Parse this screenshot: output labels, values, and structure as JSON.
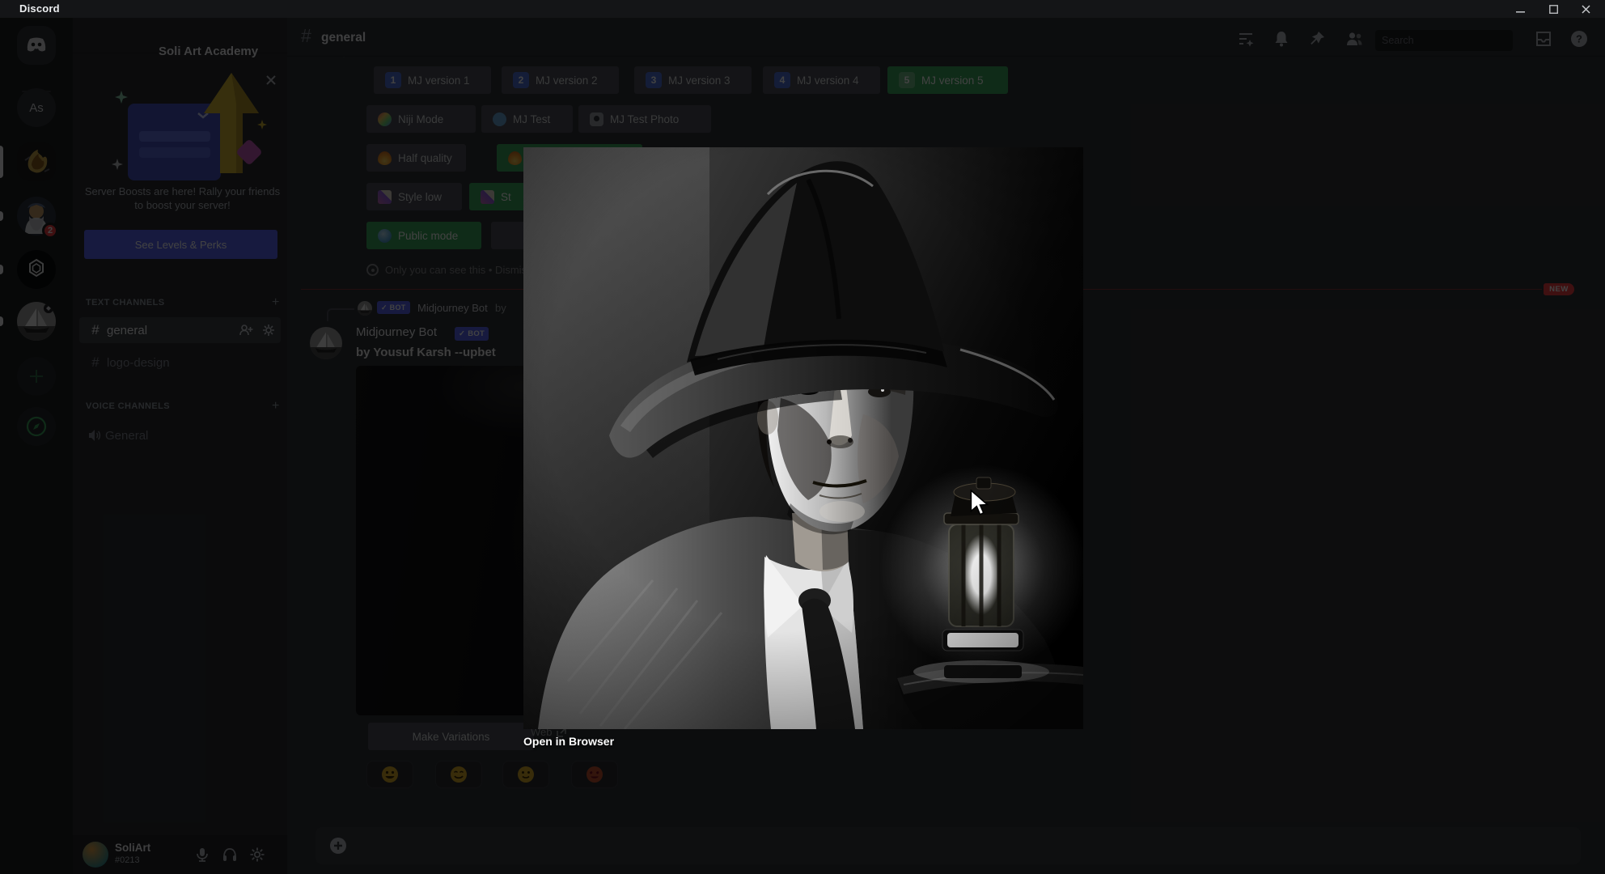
{
  "titlebar": {
    "app_name": "Discord"
  },
  "rail": {
    "as_server_label": "As",
    "wizard_badge": "2",
    "icon_names": [
      "discord-home-icon",
      "server-as",
      "server-soli-art",
      "server-wizard",
      "server-openai",
      "server-sailboat",
      "add-server-icon",
      "explore-compass-icon"
    ]
  },
  "sidebar": {
    "server_name": "Soli Art Academy",
    "boost": {
      "message": "Server Boosts are here! Rally your friends to boost your server!",
      "button_label": "See Levels & Perks"
    },
    "text_channels_label": "TEXT CHANNELS",
    "voice_channels_label": "VOICE CHANNELS",
    "channels": [
      {
        "name": "general"
      },
      {
        "name": "logo-design"
      }
    ],
    "voice_channels": [
      {
        "name": "General"
      }
    ],
    "user": {
      "name": "SoliArt",
      "tag": "#0213"
    }
  },
  "header": {
    "channel_name": "general",
    "search_placeholder": "Search",
    "icon_names": [
      "threads-icon",
      "notifications-bell-icon",
      "pin-icon",
      "member-list-icon",
      "search-icon",
      "inbox-icon",
      "help-icon"
    ]
  },
  "chat": {
    "rows": {
      "r1": [
        {
          "num": "1",
          "label": "MJ version 1"
        },
        {
          "num": "2",
          "label": "MJ version 2"
        },
        {
          "num": "3",
          "label": "MJ version 3"
        },
        {
          "num": "4",
          "label": "MJ version 4"
        },
        {
          "num": "5",
          "label": "MJ version 5"
        }
      ],
      "r2": [
        {
          "label": "Niji Mode"
        },
        {
          "label": "MJ Test"
        },
        {
          "label": "MJ Test Photo"
        }
      ],
      "r3": [
        {
          "label": "Half quality"
        },
        {
          "label": ""
        }
      ],
      "r4": [
        {
          "label": "Style low"
        },
        {
          "label": "St"
        }
      ],
      "r5": [
        {
          "label": "Public mode"
        },
        {
          "label": ""
        }
      ]
    },
    "ephemeral_note": "Only you can see this • Dismiss message",
    "new_divider_label": "NEW",
    "reply": {
      "bot_badge": "✓ BOT",
      "author": "Midjourney Bot",
      "preview": "by"
    },
    "message": {
      "author": "Midjourney Bot",
      "bot_badge": "✓ BOT",
      "content": "by Yousuf Karsh --upbet",
      "variations_button": "Make Variations",
      "web_link": "Web",
      "reaction_icons": [
        "grinning-face",
        "smiling-face",
        "slightly-smiling-face",
        "heart-eyes-face"
      ]
    }
  },
  "lightbox": {
    "open_link": "Open in Browser"
  }
}
